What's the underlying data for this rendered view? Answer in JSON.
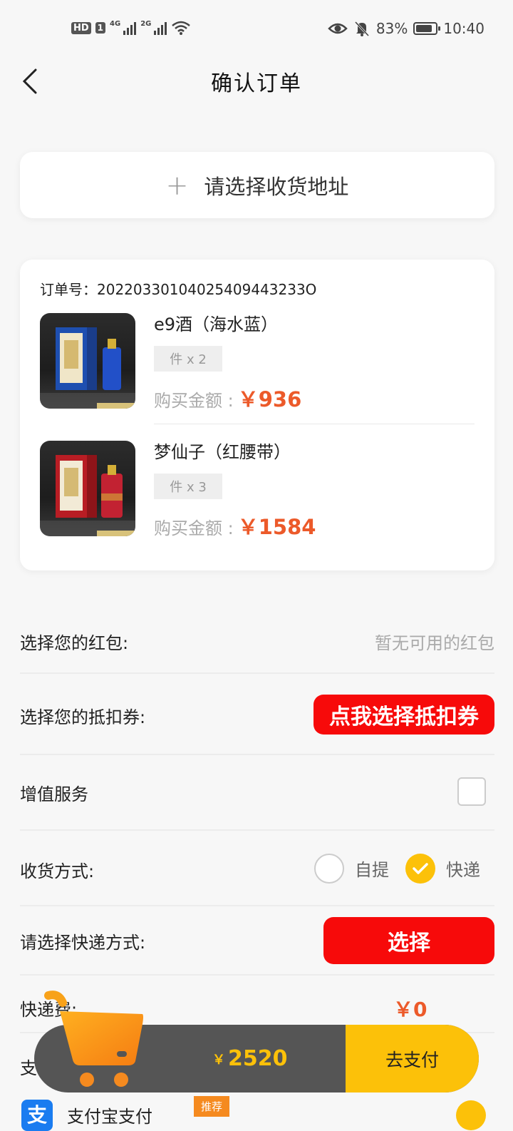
{
  "status_bar": {
    "hd": "HD",
    "sim": "1",
    "net1": "4G",
    "net2": "2G",
    "battery_text": "83%",
    "battery_level": 0.83,
    "time": "10:40"
  },
  "nav": {
    "title": "确认订单"
  },
  "address": {
    "prompt": "请选择收货地址"
  },
  "order": {
    "number": "订单号：20220330104025409443233O",
    "items": [
      {
        "name": "e9酒（海水蓝）",
        "quantity": "件 x 2",
        "amount_label": "购买金额 :",
        "price": "￥936"
      },
      {
        "name": "梦仙子（红腰带）",
        "quantity": "件 x 3",
        "amount_label": "购买金额 :",
        "price": "￥1584"
      }
    ]
  },
  "red_packet": {
    "label": "选择您的红包:",
    "value": "暂无可用的红包"
  },
  "coupon": {
    "label": "选择您的抵扣券:",
    "button": "点我选择抵扣券"
  },
  "value_added": {
    "label": "增值服务"
  },
  "delivery_method": {
    "label": "收货方式:",
    "options": [
      "自提",
      "快递"
    ],
    "selected": "快递"
  },
  "express": {
    "label": "请选择快递方式:",
    "button": "选择"
  },
  "shipping_fee": {
    "label": "快递费:",
    "value": "￥0"
  },
  "payment": {
    "label": "支付方式:",
    "alipay_label": "支付宝支付",
    "badge": "推荐",
    "alipay_icon_char": "支"
  },
  "bottom": {
    "currency": "￥",
    "total": "2520",
    "pay_button": "去支付"
  },
  "colors": {
    "accent": "#fcc109",
    "price": "#ec5a2a",
    "red_button": "#f70a0a",
    "bar": "#555555"
  }
}
